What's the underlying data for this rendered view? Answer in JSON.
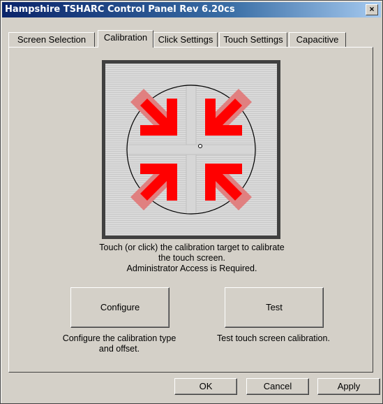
{
  "window": {
    "title": "Hampshire TSHARC Control Panel Rev 6.20cs",
    "close_label": "×"
  },
  "tabs": [
    {
      "label": "Screen Selection",
      "active": false
    },
    {
      "label": "Calibration",
      "active": true
    },
    {
      "label": "Click Settings",
      "active": false
    },
    {
      "label": "Touch Settings",
      "active": false
    },
    {
      "label": "Capacitive",
      "active": false
    }
  ],
  "calibration": {
    "instructions": [
      "Touch (or click) the calibration target to calibrate",
      "the touch screen.",
      "Administrator Access is Required."
    ],
    "target_colors": {
      "arrow_dark": "#ff0000",
      "arrow_light": "#e08080"
    }
  },
  "configure": {
    "label": "Configure",
    "caption": [
      "Configure the calibration type",
      "and offset."
    ]
  },
  "test": {
    "label": "Test",
    "caption": [
      "Test touch screen calibration."
    ]
  },
  "dialog_buttons": {
    "ok": "OK",
    "cancel": "Cancel",
    "apply": "Apply"
  }
}
